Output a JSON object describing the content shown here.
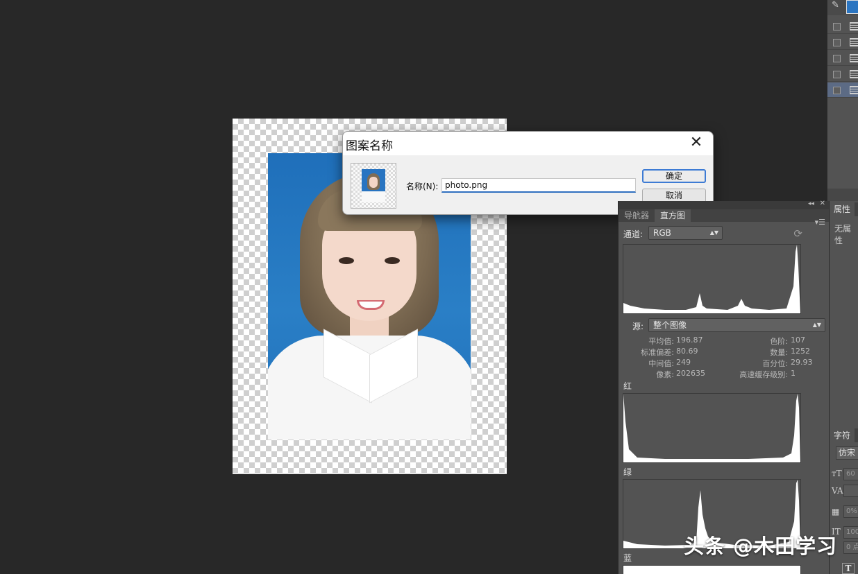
{
  "dialog": {
    "title": "图案名称",
    "name_label": "名称(N):",
    "name_value": "photo.png",
    "ok_label": "确定",
    "cancel_label": "取消"
  },
  "histogram_panel": {
    "tabs": [
      "导航器",
      "直方图"
    ],
    "active_tab": "直方图",
    "channel_label": "通道:",
    "channel_value": "RGB",
    "source_label": "源:",
    "source_value": "整个图像",
    "stats_left": [
      {
        "label": "平均值:",
        "value": "196.87"
      },
      {
        "label": "标准偏差:",
        "value": "80.69"
      },
      {
        "label": "中间值:",
        "value": "249"
      },
      {
        "label": "像素:",
        "value": "202635"
      }
    ],
    "stats_right": [
      {
        "label": "色阶:",
        "value": "107"
      },
      {
        "label": "数量:",
        "value": "1252"
      },
      {
        "label": "百分位:",
        "value": "29.93"
      },
      {
        "label": "高速缓存级别:",
        "value": "1"
      }
    ],
    "red_label": "红",
    "green_label": "绿",
    "blue_label": "蓝"
  },
  "properties_panel": {
    "title": "属性",
    "empty_text": "无属性"
  },
  "character_panel": {
    "title": "字符",
    "font_value": "仿宋",
    "size_value": "60",
    "tracking_value": "0%",
    "scale_value": "100",
    "baseline_value": "0 点"
  },
  "watermark": "头条 @木田学习",
  "colors": {
    "canvas_bg": "#282828",
    "panel_bg": "#535353",
    "photo_bg": "#2a7fc6",
    "dialog_accent": "#3d7bd4"
  }
}
